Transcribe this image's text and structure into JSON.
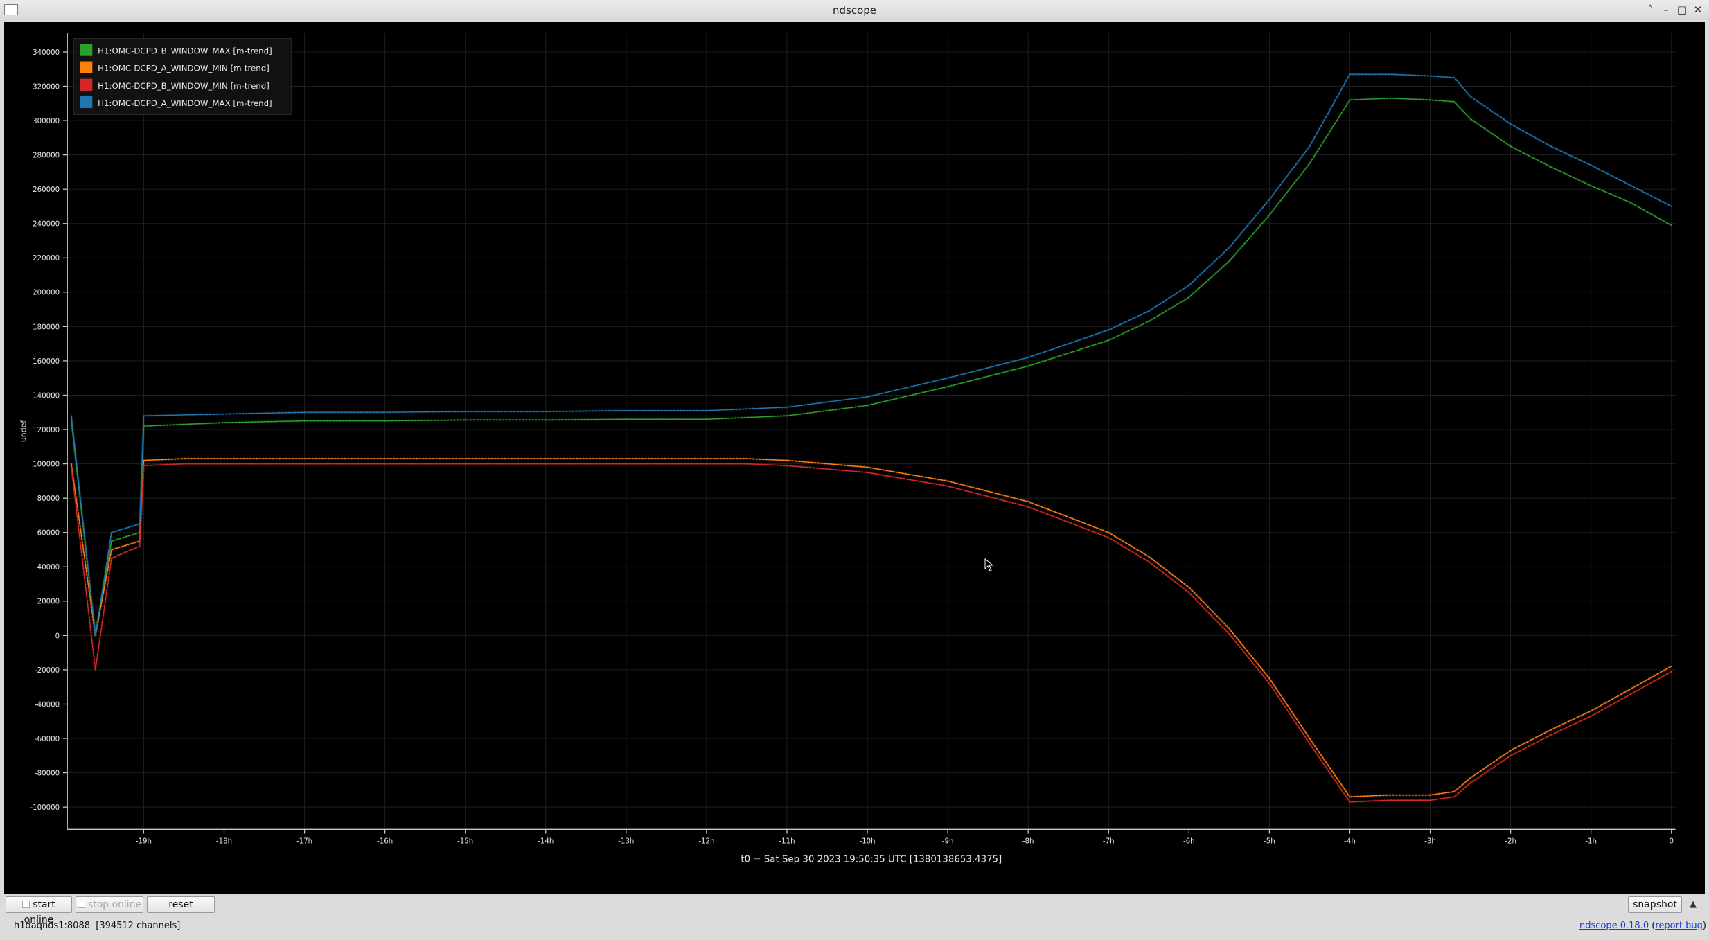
{
  "window": {
    "title": "ndscope",
    "buttons": {
      "collapse": "˄",
      "minimize": "–",
      "maximize": "□",
      "close": "✕"
    }
  },
  "plot": {
    "ylabel": "undef",
    "t0_label": "t0 = Sat Sep 30 2023 19:50:35 UTC [1380138653.4375]",
    "colors": {
      "background": "#000000",
      "grid": "#1f1f1f",
      "axis": "#c8c8c8",
      "text": "#e6e6e6"
    }
  },
  "chart_data": {
    "type": "line",
    "title": "",
    "xlabel": "",
    "ylabel": "undef",
    "x_unit": "hours relative to t0",
    "xlim": [
      -19.95,
      0.05
    ],
    "ylim": [
      -113000,
      351000
    ],
    "grid": true,
    "legend_position": "top-left",
    "x_ticks": [
      {
        "value": -19,
        "label": "-19h"
      },
      {
        "value": -18,
        "label": "-18h"
      },
      {
        "value": -17,
        "label": "-17h"
      },
      {
        "value": -16,
        "label": "-16h"
      },
      {
        "value": -15,
        "label": "-15h"
      },
      {
        "value": -14,
        "label": "-14h"
      },
      {
        "value": -13,
        "label": "-13h"
      },
      {
        "value": -12,
        "label": "-12h"
      },
      {
        "value": -11,
        "label": "-11h"
      },
      {
        "value": -10,
        "label": "-10h"
      },
      {
        "value": -9,
        "label": "-9h"
      },
      {
        "value": -8,
        "label": "-8h"
      },
      {
        "value": -7,
        "label": "-7h"
      },
      {
        "value": -6,
        "label": "-6h"
      },
      {
        "value": -5,
        "label": "-5h"
      },
      {
        "value": -4,
        "label": "-4h"
      },
      {
        "value": -3,
        "label": "-3h"
      },
      {
        "value": -2,
        "label": "-2h"
      },
      {
        "value": -1,
        "label": "-1h"
      },
      {
        "value": 0,
        "label": "0"
      }
    ],
    "y_ticks": [
      {
        "value": 340000,
        "label": "340000"
      },
      {
        "value": 320000,
        "label": "320000"
      },
      {
        "value": 300000,
        "label": "300000"
      },
      {
        "value": 280000,
        "label": "280000"
      },
      {
        "value": 260000,
        "label": "260000"
      },
      {
        "value": 240000,
        "label": "240000"
      },
      {
        "value": 220000,
        "label": "220000"
      },
      {
        "value": 200000,
        "label": "200000"
      },
      {
        "value": 180000,
        "label": "180000"
      },
      {
        "value": 160000,
        "label": "160000"
      },
      {
        "value": 140000,
        "label": "140000"
      },
      {
        "value": 120000,
        "label": "120000"
      },
      {
        "value": 100000,
        "label": "100000"
      },
      {
        "value": 80000,
        "label": "80000"
      },
      {
        "value": 60000,
        "label": "60000"
      },
      {
        "value": 40000,
        "label": "40000"
      },
      {
        "value": 20000,
        "label": "20000"
      },
      {
        "value": 0,
        "label": "0"
      },
      {
        "value": -20000,
        "label": "-20000"
      },
      {
        "value": -40000,
        "label": "-40000"
      },
      {
        "value": -60000,
        "label": "-60000"
      },
      {
        "value": -80000,
        "label": "-80000"
      },
      {
        "value": -100000,
        "label": "-100000"
      }
    ],
    "series": [
      {
        "name": "H1:OMC-DCPD_B_WINDOW_MAX [m-trend]",
        "color": "#2ca02c",
        "x": [
          -19.9,
          -19.6,
          -19.4,
          -19.05,
          -19.0,
          -18.5,
          -18.0,
          -17.0,
          -16.0,
          -15.0,
          -14.0,
          -13.0,
          -12.0,
          -11.0,
          -10.0,
          -9.0,
          -8.0,
          -7.0,
          -6.5,
          -6.0,
          -5.5,
          -5.0,
          -4.5,
          -4.0,
          -3.5,
          -3.0,
          -2.7,
          -2.5,
          -2.0,
          -1.5,
          -1.0,
          -0.5,
          0.0
        ],
        "y": [
          125000,
          0,
          55000,
          60000,
          122000,
          123000,
          124000,
          125000,
          125000,
          125500,
          125500,
          126000,
          126000,
          128000,
          134000,
          145000,
          157000,
          172000,
          183000,
          197000,
          218000,
          245000,
          275000,
          312000,
          313000,
          312000,
          311000,
          301000,
          285000,
          273000,
          262000,
          252000,
          239000
        ]
      },
      {
        "name": "H1:OMC-DCPD_A_WINDOW_MIN [m-trend]",
        "color": "#ff7f0e",
        "x": [
          -19.9,
          -19.6,
          -19.4,
          -19.05,
          -19.0,
          -18.5,
          -18.0,
          -17.0,
          -16.0,
          -15.0,
          -14.0,
          -13.0,
          -12.0,
          -11.5,
          -11.0,
          -10.0,
          -9.0,
          -8.0,
          -7.0,
          -6.5,
          -6.0,
          -5.5,
          -5.0,
          -4.5,
          -4.0,
          -3.5,
          -3.0,
          -2.7,
          -2.5,
          -2.0,
          -1.5,
          -1.0,
          -0.5,
          0.0
        ],
        "y": [
          100000,
          0,
          50000,
          55000,
          102000,
          103000,
          103000,
          103000,
          103000,
          103000,
          103000,
          103000,
          103000,
          103000,
          102000,
          98000,
          90000,
          78000,
          60000,
          46000,
          28000,
          4000,
          -25000,
          -60000,
          -94000,
          -93000,
          -93000,
          -91000,
          -83000,
          -67000,
          -55000,
          -44000,
          -31000,
          -18000
        ]
      },
      {
        "name": "H1:OMC-DCPD_B_WINDOW_MIN [m-trend]",
        "color": "#d62728",
        "x": [
          -19.9,
          -19.6,
          -19.4,
          -19.05,
          -19.0,
          -18.5,
          -18.0,
          -17.0,
          -16.0,
          -15.0,
          -14.0,
          -13.0,
          -12.0,
          -11.5,
          -11.0,
          -10.0,
          -9.0,
          -8.0,
          -7.0,
          -6.5,
          -6.0,
          -5.5,
          -5.0,
          -4.5,
          -4.0,
          -3.5,
          -3.0,
          -2.7,
          -2.5,
          -2.0,
          -1.5,
          -1.0,
          -0.5,
          0.0
        ],
        "y": [
          98000,
          -20000,
          45000,
          52000,
          99000,
          100000,
          100000,
          100000,
          100000,
          100000,
          100000,
          100000,
          100000,
          100000,
          99000,
          95000,
          87000,
          75000,
          57000,
          43000,
          25000,
          1000,
          -28000,
          -63000,
          -97000,
          -96000,
          -96000,
          -94000,
          -86000,
          -70000,
          -58000,
          -47000,
          -34000,
          -21000
        ]
      },
      {
        "name": "H1:OMC-DCPD_A_WINDOW_MAX [m-trend]",
        "color": "#1f77b4",
        "x": [
          -19.9,
          -19.6,
          -19.4,
          -19.05,
          -19.0,
          -18.5,
          -18.0,
          -17.0,
          -16.0,
          -15.0,
          -14.0,
          -13.0,
          -12.0,
          -11.0,
          -10.0,
          -9.0,
          -8.0,
          -7.0,
          -6.5,
          -6.0,
          -5.5,
          -5.0,
          -4.5,
          -4.0,
          -3.5,
          -3.0,
          -2.7,
          -2.5,
          -2.0,
          -1.5,
          -1.0,
          -0.5,
          0.0
        ],
        "y": [
          128000,
          0,
          60000,
          65000,
          128000,
          128500,
          129000,
          130000,
          130000,
          130500,
          130500,
          131000,
          131000,
          133000,
          139000,
          150000,
          162000,
          178000,
          189000,
          204000,
          226000,
          254000,
          285000,
          327000,
          327000,
          326000,
          325000,
          314000,
          298000,
          285000,
          274000,
          262000,
          250000
        ]
      }
    ]
  },
  "toolbar": {
    "start_online": "start online",
    "stop_online": "stop online",
    "reset": "reset",
    "snapshot": "snapshot",
    "expand_icon": "▲"
  },
  "status": {
    "server": "h1daqnds1:8088",
    "channels": "[394512 channels]",
    "version_link": "ndscope 0.18.0",
    "report_open": "(",
    "report_link": "report bug",
    "report_close": ")"
  }
}
